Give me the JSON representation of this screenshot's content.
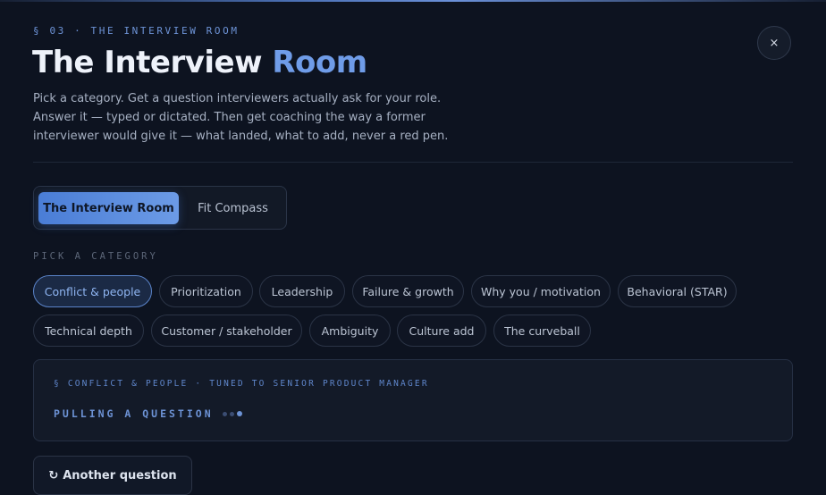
{
  "header": {
    "eyebrow": "§ 03 · THE INTERVIEW ROOM",
    "title_main": "The Interview",
    "title_accent": "Room",
    "close_label": "×",
    "description": "Pick a category. Get a question interviewers actually ask for your role. Answer it — typed or dictated. Then get coaching the way a former interviewer would give it — what landed, what to add, never a red pen."
  },
  "mode_tabs": {
    "active": "The Interview Room",
    "inactive": "Fit Compass"
  },
  "categories": {
    "label": "PICK A CATEGORY",
    "selected": "Conflict & people",
    "items": [
      "Conflict & people",
      "Prioritization",
      "Leadership",
      "Failure & growth",
      "Why you / motivation",
      "Behavioral (STAR)",
      "Technical depth",
      "Customer / stakeholder",
      "Ambiguity",
      "Culture add",
      "The curveball"
    ]
  },
  "question_card": {
    "meta": "§ CONFLICT & PEOPLE · TUNED TO SENIOR PRODUCT MANAGER",
    "status": "PULLING A QUESTION"
  },
  "actions": {
    "another_icon": "↻",
    "another_label": "Another question"
  },
  "colors": {
    "background": "#0d1320",
    "accent": "#6f9ce8",
    "chip_selected": "#8fb5f2"
  }
}
